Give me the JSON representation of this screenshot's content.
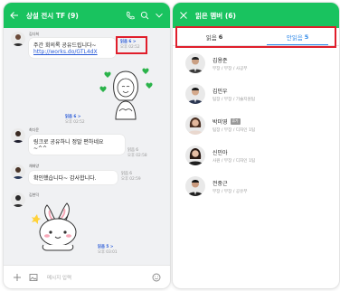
{
  "chat": {
    "title": "상설 전시 TF (9)",
    "input_placeholder": "메시지 입력",
    "messages": [
      {
        "sender": "김다희",
        "lines": [
          "주간 회의록 공유드립니다~",
          "http://works.do/GTL4dX"
        ],
        "read": "읽음 6 >",
        "time": "오후 02:52"
      },
      {
        "read": "읽음 6 >",
        "time": "오후 02:52"
      },
      {
        "sender": "최다윤",
        "lines": [
          "링크로 공유하니 정말 편하네요",
          "~^^"
        ],
        "read": "읽음 6",
        "time": "오후 02:58"
      },
      {
        "sender": "채태양",
        "lines": [
          "확인했습니다~ 감사합니다."
        ],
        "read": "읽음 6",
        "time": "오후 02:59"
      },
      {
        "sender": "김현덕",
        "read": "읽음 5 >",
        "time": "오후 03:01"
      }
    ]
  },
  "read_members": {
    "title": "읽은 멤버 (6)",
    "tabs": [
      {
        "label": "읽음",
        "count": "6"
      },
      {
        "label": "안읽음",
        "count": "5"
      }
    ],
    "members": [
      {
        "name": "김용준",
        "role": "부장 / 부장 / 사공부",
        "tag": ""
      },
      {
        "name": "김민우",
        "role": "팀장 / 부장 / 기술지원팀",
        "tag": ""
      },
      {
        "name": "박미영",
        "role": "팀장 / 부장 / 디자인 1팀",
        "tag": "휴가"
      },
      {
        "name": "신민아",
        "role": "사원 / 부장 / 디자인 1팀",
        "tag": ""
      },
      {
        "name": "전중근",
        "role": "부장 / 부장 / 공유부",
        "tag": ""
      }
    ]
  },
  "colors": {
    "brand_green": "#19c35f",
    "highlight_red": "#e01e2b",
    "active_tab_blue": "#2a86e8"
  },
  "icons": [
    "back-arrow-icon",
    "phone-icon",
    "search-icon",
    "chevron-down-icon",
    "plus-icon",
    "image-icon",
    "emoji-icon",
    "close-icon"
  ]
}
